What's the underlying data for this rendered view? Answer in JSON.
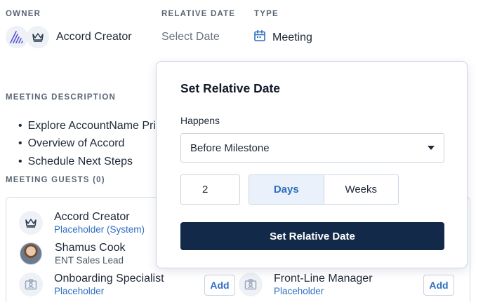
{
  "header": {
    "owner_label": "OWNER",
    "relative_date_label": "RELATIVE DATE",
    "type_label": "TYPE",
    "owner_name": "Accord Creator",
    "relative_date_value": "Select Date",
    "type_value": "Meeting"
  },
  "description": {
    "label": "MEETING DESCRIPTION",
    "items": [
      "Explore AccountName Pri",
      "Overview of Accord",
      "Schedule Next Steps"
    ]
  },
  "guests": {
    "label": "MEETING GUESTS (0)",
    "list": [
      {
        "name": "Accord Creator",
        "sub": "Placeholder (System)"
      },
      {
        "name": "Shamus Cook",
        "sub": "ENT Sales Lead"
      },
      {
        "name": "Onboarding Specialist",
        "sub": "Placeholder",
        "action": "Add"
      },
      {
        "name": "Front-Line Manager",
        "sub": "Placeholder",
        "action": "Add"
      }
    ]
  },
  "popover": {
    "title": "Set Relative Date",
    "happens_label": "Happens",
    "happens_value": "Before Milestone",
    "amount": "2",
    "unit_options": [
      "Days",
      "Weeks"
    ],
    "selected_unit": "Days",
    "submit_label": "Set Relative Date"
  },
  "colors": {
    "accent": "#2f6fbf",
    "primary_button": "#13294a",
    "muted_text": "#5b6573"
  }
}
